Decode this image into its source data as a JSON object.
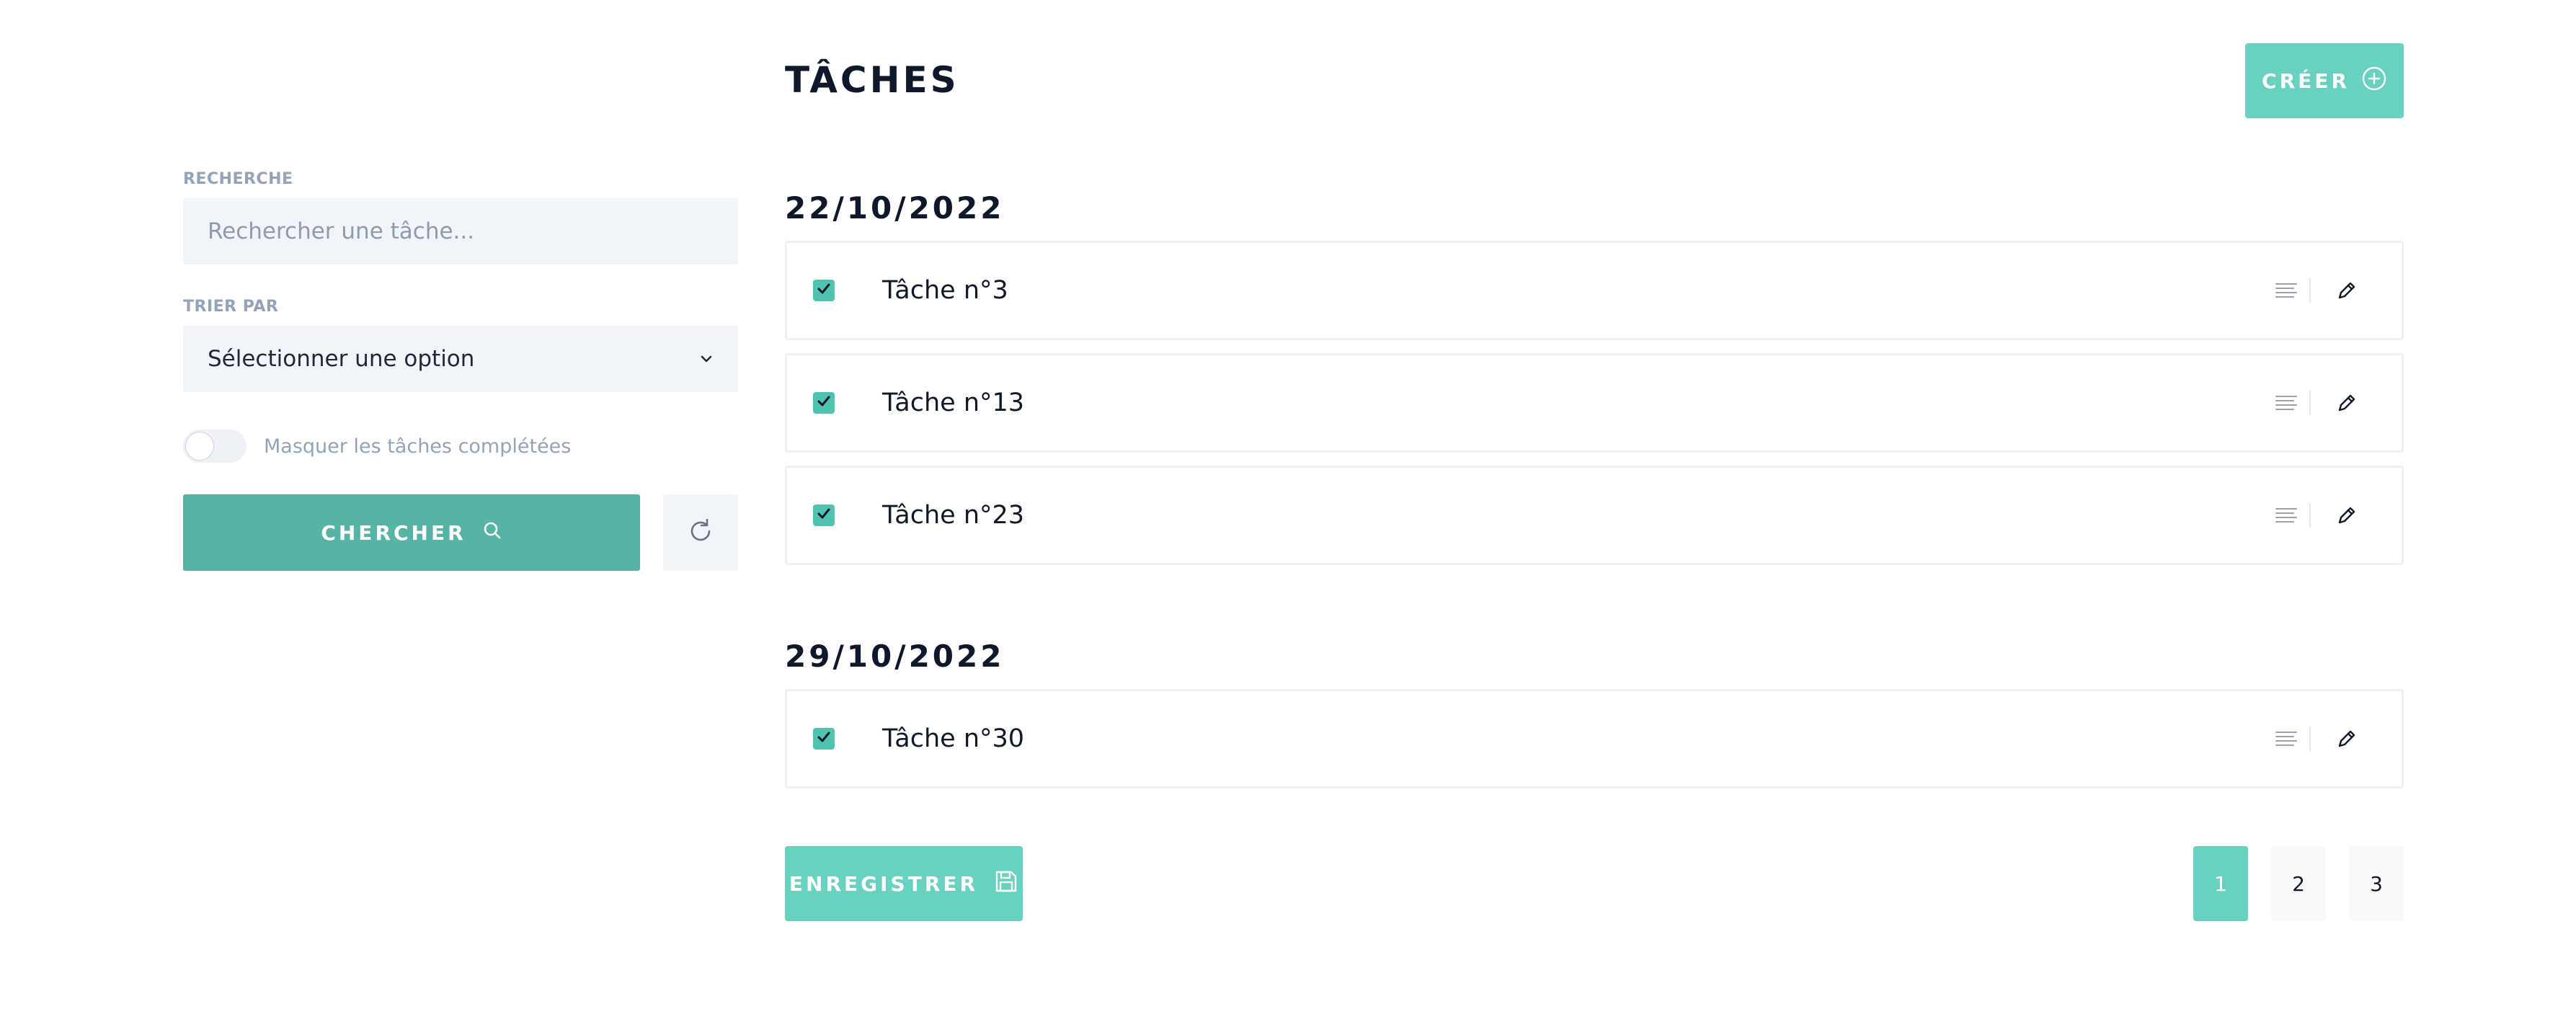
{
  "sidebar": {
    "search_label": "RECHERCHE",
    "search_placeholder": "Rechercher une tâche...",
    "search_value": "",
    "sort_label": "TRIER PAR",
    "sort_value": "Sélectionner une option",
    "hide_completed_label": "Masquer les tâches complétées",
    "hide_completed_on": false,
    "search_button_label": "CHERCHER"
  },
  "header": {
    "title": "TÂCHES",
    "create_button_label": "CRÉER"
  },
  "groups": [
    {
      "date": "22/10/2022",
      "tasks": [
        {
          "name": "Tâche n°3",
          "completed": true
        },
        {
          "name": "Tâche n°13",
          "completed": true
        },
        {
          "name": "Tâche n°23",
          "completed": true
        }
      ]
    },
    {
      "date": "29/10/2022",
      "tasks": [
        {
          "name": "Tâche n°30",
          "completed": true
        }
      ]
    }
  ],
  "footer": {
    "save_button_label": "ENREGISTRER",
    "pages": [
      "1",
      "2",
      "3"
    ],
    "current_page": "1"
  },
  "colors": {
    "accent": "#68d1c0",
    "accent_dark": "#55b4a5",
    "input_bg": "#f1f4f8"
  },
  "icons": [
    "search-icon",
    "refresh-icon",
    "plus-circle-icon",
    "chevron-down-icon",
    "check-icon",
    "description-icon",
    "edit-icon",
    "save-icon"
  ]
}
